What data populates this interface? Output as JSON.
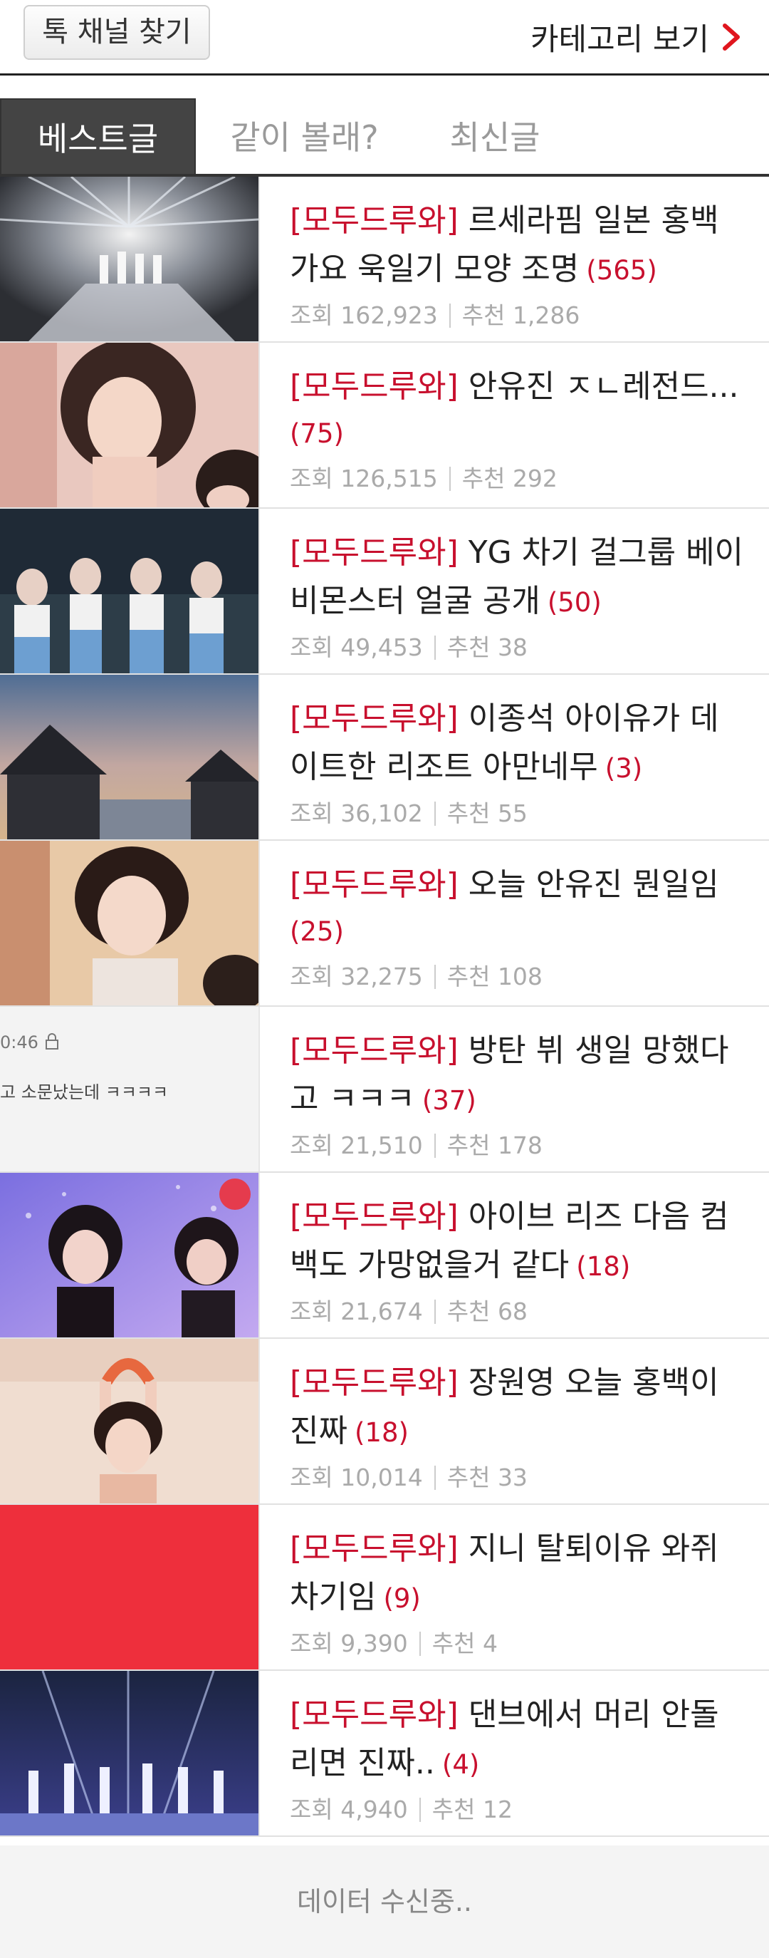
{
  "header": {
    "find_channel_label": "톡 채널 찾기",
    "category_label": "카테고리 보기"
  },
  "tabs": [
    {
      "label": "베스트글",
      "active": true
    },
    {
      "label": "같이 볼래?",
      "active": false
    },
    {
      "label": "최신글",
      "active": false
    }
  ],
  "posts": [
    {
      "prefix": "[모두드루와]",
      "title": "르세라핌 일본 홍백 가요 욱일기 모양 조명",
      "comments": "(565)",
      "views_label": "조회",
      "views": "162,923",
      "likes_label": "추천",
      "likes": "1,286",
      "thumb": "stage-lights"
    },
    {
      "prefix": "[모두드루와]",
      "title": "안유진 ㅈㄴ레전드...",
      "comments": "(75)",
      "views_label": "조회",
      "views": "126,515",
      "likes_label": "추천",
      "likes": "292",
      "thumb": "portrait-pink"
    },
    {
      "prefix": "[모두드루와]",
      "title": "YG 차기 걸그룹 베이비몬스터 얼굴 공개",
      "comments": "(50)",
      "views_label": "조회",
      "views": "49,453",
      "likes_label": "추천",
      "likes": "38",
      "thumb": "dance-group"
    },
    {
      "prefix": "[모두드루와]",
      "title": "이종석 아이유가 데이트한 리조트 아만네무",
      "comments": "(3)",
      "views_label": "조회",
      "views": "36,102",
      "likes_label": "추천",
      "likes": "55",
      "thumb": "resort-sunset"
    },
    {
      "prefix": "[모두드루와]",
      "title": "오늘 안유진 뭔일임",
      "comments": "(25)",
      "views_label": "조회",
      "views": "32,275",
      "likes_label": "추천",
      "likes": "108",
      "thumb": "portrait-gold"
    },
    {
      "prefix": "[모두드루와]",
      "title": "방탄 뷔 생일 망했다고 ㅋㅋㅋ",
      "comments": "(37)",
      "views_label": "조회",
      "views": "21,510",
      "likes_label": "추천",
      "likes": "178",
      "thumb": "chat-capture",
      "thumb_time": "0:46",
      "thumb_text": "고 소문났는데 ㅋㅋㅋㅋ"
    },
    {
      "prefix": "[모두드루와]",
      "title": "아이브 리즈 다음 컴백도 가망없을거 같다",
      "comments": "(18)",
      "views_label": "조회",
      "views": "21,674",
      "likes_label": "추천",
      "likes": "68",
      "thumb": "purple-stage"
    },
    {
      "prefix": "[모두드루와]",
      "title": "장원영 오늘 홍백이 진짜",
      "comments": "(18)",
      "views_label": "조회",
      "views": "10,014",
      "likes_label": "추천",
      "likes": "33",
      "thumb": "heart-pose"
    },
    {
      "prefix": "[모두드루와]",
      "title": "지니 탈퇴이유 와쥐 차기임",
      "comments": "(9)",
      "views_label": "조회",
      "views": "9,390",
      "likes_label": "추천",
      "likes": "4",
      "thumb": "solid-red"
    },
    {
      "prefix": "[모두드루와]",
      "title": "댄브에서 머리 안돌리면 진짜..",
      "comments": "(4)",
      "views_label": "조회",
      "views": "4,940",
      "likes_label": "추천",
      "likes": "12",
      "thumb": "dark-stage"
    }
  ],
  "footer": {
    "loading_text": "데이터 수신중.."
  },
  "colors": {
    "accent_red": "#c8102e",
    "tab_active_bg": "#444444",
    "meta_gray": "#aaaaaa"
  }
}
